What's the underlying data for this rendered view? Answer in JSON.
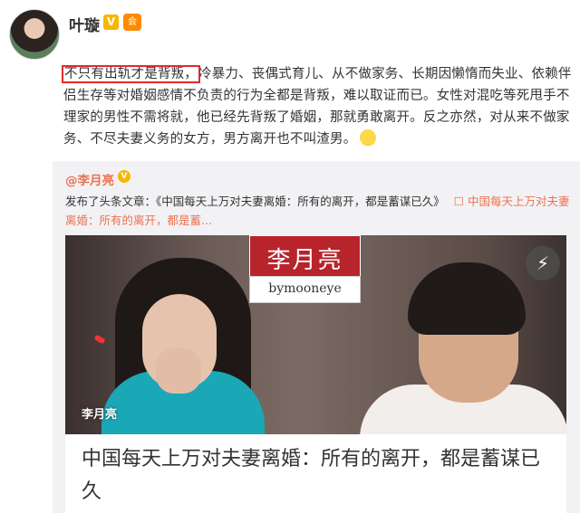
{
  "post": {
    "username": "叶璇",
    "verified_badge": "V",
    "member_icon": "会",
    "text_highlight": "不只有出轨才是背叛，",
    "text_rest": "冷暴力、丧偶式育儿、从不做家务、长期因懒惰而失业、依赖伴侣生存等对婚姻感情不负责的行为全都是背叛，难以取证而已。女性对混吃等死甩手不理家的男性不需将就，他已经先背叛了婚姻，那就勇敢离开。反之亦然，对从来不做家务、不尽夫妻义务的女方，男方离开也不叫渣男。",
    "emoji": "smile-emoji"
  },
  "repost": {
    "author": "@李月亮",
    "verified_badge": "V",
    "text_prefix": "发布了头条文章：《中国每天上万对夫妻离婚：所有的离开，都是蓄谋已久》",
    "link_icon": "☐",
    "link_text": "中国每天上万对夫妻离婚：所有的离开，都是蓄...",
    "article": {
      "logo_cn": "李月亮",
      "logo_en": "bymooneye",
      "watermark": "李月亮",
      "flash_icon": "⚡",
      "title": "中国每天上万对夫妻离婚：所有的离开，都是蓄谋已久"
    }
  },
  "colors": {
    "link": "#eb7350",
    "highlight_border": "#e02a2a",
    "verified": "#f7b600",
    "logo_red": "#b8242c"
  }
}
